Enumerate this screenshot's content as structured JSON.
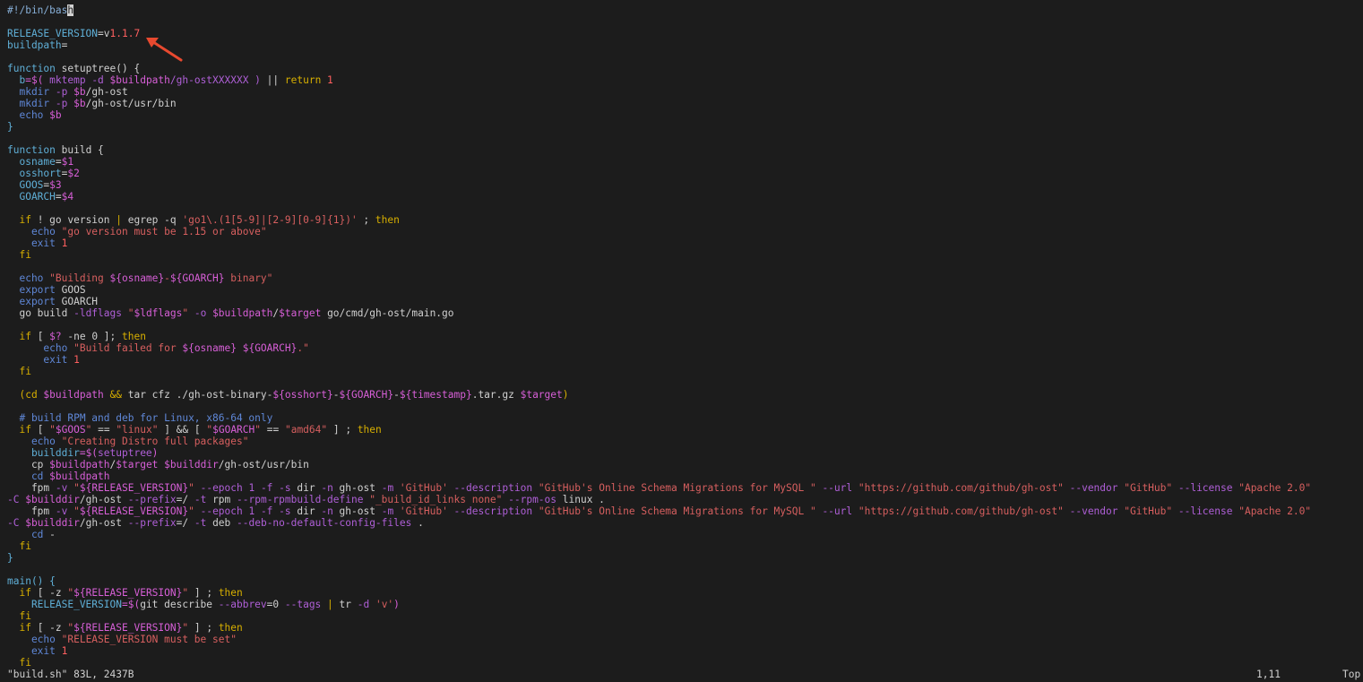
{
  "editor": {
    "lines": [
      [
        {
          "t": "#!/bin/bas",
          "c": "shebang"
        },
        {
          "t": "h",
          "c": "cursor"
        }
      ],
      [],
      [
        {
          "t": "RELEASE_VERSION",
          "c": "var"
        },
        {
          "t": "=v",
          "c": "pln"
        },
        {
          "t": "1.1.7",
          "c": "num"
        }
      ],
      [
        {
          "t": "buildpath",
          "c": "var"
        },
        {
          "t": "=",
          "c": "pln"
        }
      ],
      [],
      [
        {
          "t": "function",
          "c": "kw"
        },
        {
          "t": " setuptree() {",
          "c": "pln"
        }
      ],
      [
        {
          "t": "  b",
          "c": "var"
        },
        {
          "t": "=$( ",
          "c": "sub"
        },
        {
          "t": "mktemp -d ",
          "c": "opt"
        },
        {
          "t": "$buildpath",
          "c": "sub"
        },
        {
          "t": "/gh-ostXXXXXX ) ",
          "c": "opt"
        },
        {
          "t": "|| ",
          "c": "pln"
        },
        {
          "t": "return",
          "c": "ctl"
        },
        {
          "t": " 1",
          "c": "num"
        }
      ],
      [
        {
          "t": "  mkdir ",
          "c": "cmd"
        },
        {
          "t": "-p ",
          "c": "opt"
        },
        {
          "t": "$b",
          "c": "sub"
        },
        {
          "t": "/gh-ost",
          "c": "pln"
        }
      ],
      [
        {
          "t": "  mkdir ",
          "c": "cmd"
        },
        {
          "t": "-p ",
          "c": "opt"
        },
        {
          "t": "$b",
          "c": "sub"
        },
        {
          "t": "/gh-ost/usr/bin",
          "c": "pln"
        }
      ],
      [
        {
          "t": "  echo ",
          "c": "cmd"
        },
        {
          "t": "$b",
          "c": "sub"
        }
      ],
      [
        {
          "t": "}",
          "c": "brace"
        }
      ],
      [],
      [
        {
          "t": "function",
          "c": "kw"
        },
        {
          "t": " build {",
          "c": "pln"
        }
      ],
      [
        {
          "t": "  osname",
          "c": "var"
        },
        {
          "t": "=",
          "c": "pln"
        },
        {
          "t": "$1",
          "c": "sub"
        }
      ],
      [
        {
          "t": "  osshort",
          "c": "var"
        },
        {
          "t": "=",
          "c": "pln"
        },
        {
          "t": "$2",
          "c": "sub"
        }
      ],
      [
        {
          "t": "  GOOS",
          "c": "var"
        },
        {
          "t": "=",
          "c": "pln"
        },
        {
          "t": "$3",
          "c": "sub"
        }
      ],
      [
        {
          "t": "  GOARCH",
          "c": "var"
        },
        {
          "t": "=",
          "c": "pln"
        },
        {
          "t": "$4",
          "c": "sub"
        }
      ],
      [],
      [
        {
          "t": "  if",
          "c": "ctl"
        },
        {
          "t": " ! go version ",
          "c": "pln"
        },
        {
          "t": "| ",
          "c": "ctl"
        },
        {
          "t": "egrep -q ",
          "c": "pln"
        },
        {
          "t": "'go1\\.(1[5-9]|[2-9][0-9]{1})'",
          "c": "str"
        },
        {
          "t": " ; ",
          "c": "pln"
        },
        {
          "t": "then",
          "c": "ctl"
        }
      ],
      [
        {
          "t": "    echo ",
          "c": "cmd"
        },
        {
          "t": "\"go version must be 1.15 or above\"",
          "c": "str"
        }
      ],
      [
        {
          "t": "    exit ",
          "c": "cmd"
        },
        {
          "t": "1",
          "c": "num"
        }
      ],
      [
        {
          "t": "  fi",
          "c": "ctl"
        }
      ],
      [],
      [
        {
          "t": "  echo ",
          "c": "cmd"
        },
        {
          "t": "\"Building ",
          "c": "str"
        },
        {
          "t": "${osname}",
          "c": "sub"
        },
        {
          "t": "-",
          "c": "str"
        },
        {
          "t": "${GOARCH}",
          "c": "sub"
        },
        {
          "t": " binary\"",
          "c": "str"
        }
      ],
      [
        {
          "t": "  export ",
          "c": "cmd"
        },
        {
          "t": "GOOS",
          "c": "pln"
        }
      ],
      [
        {
          "t": "  export ",
          "c": "cmd"
        },
        {
          "t": "GOARCH",
          "c": "pln"
        }
      ],
      [
        {
          "t": "  go build ",
          "c": "pln"
        },
        {
          "t": "-ldflags ",
          "c": "opt"
        },
        {
          "t": "\"",
          "c": "str"
        },
        {
          "t": "$ldflags",
          "c": "sub"
        },
        {
          "t": "\" ",
          "c": "str"
        },
        {
          "t": "-o ",
          "c": "opt"
        },
        {
          "t": "$buildpath",
          "c": "sub"
        },
        {
          "t": "/",
          "c": "pln"
        },
        {
          "t": "$target",
          "c": "sub"
        },
        {
          "t": " go/cmd/gh-ost/main.go",
          "c": "pln"
        }
      ],
      [],
      [
        {
          "t": "  if",
          "c": "ctl"
        },
        {
          "t": " [ ",
          "c": "pln"
        },
        {
          "t": "$?",
          "c": "sub"
        },
        {
          "t": " -ne 0 ]; ",
          "c": "pln"
        },
        {
          "t": "then",
          "c": "ctl"
        }
      ],
      [
        {
          "t": "      echo ",
          "c": "cmd"
        },
        {
          "t": "\"Build failed for ",
          "c": "str"
        },
        {
          "t": "${osname}",
          "c": "sub"
        },
        {
          "t": " ",
          "c": "str"
        },
        {
          "t": "${GOARCH}",
          "c": "sub"
        },
        {
          "t": ".\"",
          "c": "str"
        }
      ],
      [
        {
          "t": "      exit ",
          "c": "cmd"
        },
        {
          "t": "1",
          "c": "num"
        }
      ],
      [
        {
          "t": "  fi",
          "c": "ctl"
        }
      ],
      [],
      [
        {
          "t": "  (cd ",
          "c": "ctl"
        },
        {
          "t": "$buildpath",
          "c": "sub"
        },
        {
          "t": " && ",
          "c": "ctl"
        },
        {
          "t": "tar cfz ./gh-ost-binary-",
          "c": "pln"
        },
        {
          "t": "${osshort}",
          "c": "sub"
        },
        {
          "t": "-",
          "c": "pln"
        },
        {
          "t": "${GOARCH}",
          "c": "sub"
        },
        {
          "t": "-",
          "c": "pln"
        },
        {
          "t": "${timestamp}",
          "c": "sub"
        },
        {
          "t": ".tar.gz ",
          "c": "pln"
        },
        {
          "t": "$target",
          "c": "sub"
        },
        {
          "t": ")",
          "c": "ctl"
        }
      ],
      [],
      [
        {
          "t": "  # build RPM and deb for Linux, x86-64 only",
          "c": "cmt"
        }
      ],
      [
        {
          "t": "  if",
          "c": "ctl"
        },
        {
          "t": " [ ",
          "c": "pln"
        },
        {
          "t": "\"",
          "c": "str"
        },
        {
          "t": "$GOOS",
          "c": "sub"
        },
        {
          "t": "\"",
          "c": "str"
        },
        {
          "t": " == ",
          "c": "pln"
        },
        {
          "t": "\"linux\"",
          "c": "str"
        },
        {
          "t": " ] && [ ",
          "c": "pln"
        },
        {
          "t": "\"",
          "c": "str"
        },
        {
          "t": "$GOARCH",
          "c": "sub"
        },
        {
          "t": "\"",
          "c": "str"
        },
        {
          "t": " == ",
          "c": "pln"
        },
        {
          "t": "\"amd64\"",
          "c": "str"
        },
        {
          "t": " ] ; ",
          "c": "pln"
        },
        {
          "t": "then",
          "c": "ctl"
        }
      ],
      [
        {
          "t": "    echo ",
          "c": "cmd"
        },
        {
          "t": "\"Creating Distro full packages\"",
          "c": "str"
        }
      ],
      [
        {
          "t": "    builddir",
          "c": "var"
        },
        {
          "t": "=$(",
          "c": "sub"
        },
        {
          "t": "setuptree",
          "c": "opt"
        },
        {
          "t": ")",
          "c": "sub"
        }
      ],
      [
        {
          "t": "    cp ",
          "c": "pln"
        },
        {
          "t": "$buildpath",
          "c": "sub"
        },
        {
          "t": "/",
          "c": "pln"
        },
        {
          "t": "$target",
          "c": "sub"
        },
        {
          "t": " ",
          "c": "pln"
        },
        {
          "t": "$builddir",
          "c": "sub"
        },
        {
          "t": "/gh-ost/usr/bin",
          "c": "pln"
        }
      ],
      [
        {
          "t": "    cd ",
          "c": "cmd"
        },
        {
          "t": "$buildpath",
          "c": "sub"
        }
      ],
      [
        {
          "t": "    fpm ",
          "c": "pln"
        },
        {
          "t": "-v ",
          "c": "opt"
        },
        {
          "t": "\"",
          "c": "str"
        },
        {
          "t": "${RELEASE_VERSION}",
          "c": "sub"
        },
        {
          "t": "\"",
          "c": "str"
        },
        {
          "t": " --epoch 1 -f -s ",
          "c": "opt"
        },
        {
          "t": "dir ",
          "c": "pln"
        },
        {
          "t": "-n ",
          "c": "opt"
        },
        {
          "t": "gh-ost ",
          "c": "pln"
        },
        {
          "t": "-m ",
          "c": "opt"
        },
        {
          "t": "'GitHub'",
          "c": "str"
        },
        {
          "t": " --description ",
          "c": "opt"
        },
        {
          "t": "\"GitHub's Online Schema Migrations for MySQL \"",
          "c": "str"
        },
        {
          "t": " --url ",
          "c": "opt"
        },
        {
          "t": "\"https://github.com/github/gh-ost\"",
          "c": "str"
        },
        {
          "t": " --vendor ",
          "c": "opt"
        },
        {
          "t": "\"GitHub\"",
          "c": "str"
        },
        {
          "t": " --license ",
          "c": "opt"
        },
        {
          "t": "\"Apache 2.0\"",
          "c": "str"
        }
      ],
      [
        {
          "t": "-C ",
          "c": "opt"
        },
        {
          "t": "$builddir",
          "c": "sub"
        },
        {
          "t": "/gh-ost ",
          "c": "pln"
        },
        {
          "t": "--prefix",
          "c": "opt"
        },
        {
          "t": "=/ ",
          "c": "pln"
        },
        {
          "t": "-t ",
          "c": "opt"
        },
        {
          "t": "rpm ",
          "c": "pln"
        },
        {
          "t": "--rpm-rpmbuild-define ",
          "c": "opt"
        },
        {
          "t": "\"_build_id_links none\"",
          "c": "str"
        },
        {
          "t": " --rpm-os ",
          "c": "opt"
        },
        {
          "t": "linux .",
          "c": "pln"
        }
      ],
      [
        {
          "t": "    fpm ",
          "c": "pln"
        },
        {
          "t": "-v ",
          "c": "opt"
        },
        {
          "t": "\"",
          "c": "str"
        },
        {
          "t": "${RELEASE_VERSION}",
          "c": "sub"
        },
        {
          "t": "\"",
          "c": "str"
        },
        {
          "t": " --epoch 1 -f -s ",
          "c": "opt"
        },
        {
          "t": "dir ",
          "c": "pln"
        },
        {
          "t": "-n ",
          "c": "opt"
        },
        {
          "t": "gh-ost ",
          "c": "pln"
        },
        {
          "t": "-m ",
          "c": "opt"
        },
        {
          "t": "'GitHub'",
          "c": "str"
        },
        {
          "t": " --description ",
          "c": "opt"
        },
        {
          "t": "\"GitHub's Online Schema Migrations for MySQL \"",
          "c": "str"
        },
        {
          "t": " --url ",
          "c": "opt"
        },
        {
          "t": "\"https://github.com/github/gh-ost\"",
          "c": "str"
        },
        {
          "t": " --vendor ",
          "c": "opt"
        },
        {
          "t": "\"GitHub\"",
          "c": "str"
        },
        {
          "t": " --license ",
          "c": "opt"
        },
        {
          "t": "\"Apache 2.0\"",
          "c": "str"
        }
      ],
      [
        {
          "t": "-C ",
          "c": "opt"
        },
        {
          "t": "$builddir",
          "c": "sub"
        },
        {
          "t": "/gh-ost ",
          "c": "pln"
        },
        {
          "t": "--prefix",
          "c": "opt"
        },
        {
          "t": "=/ ",
          "c": "pln"
        },
        {
          "t": "-t ",
          "c": "opt"
        },
        {
          "t": "deb ",
          "c": "pln"
        },
        {
          "t": "--deb-no-default-config-files ",
          "c": "opt"
        },
        {
          "t": ".",
          "c": "pln"
        }
      ],
      [
        {
          "t": "    cd ",
          "c": "cmd"
        },
        {
          "t": "-",
          "c": "pln"
        }
      ],
      [
        {
          "t": "  fi",
          "c": "ctl"
        }
      ],
      [
        {
          "t": "}",
          "c": "brace"
        }
      ],
      [],
      [
        {
          "t": "main() {",
          "c": "kw"
        }
      ],
      [
        {
          "t": "  if",
          "c": "ctl"
        },
        {
          "t": " [ -z ",
          "c": "pln"
        },
        {
          "t": "\"",
          "c": "str"
        },
        {
          "t": "${RELEASE_VERSION}",
          "c": "sub"
        },
        {
          "t": "\"",
          "c": "str"
        },
        {
          "t": " ] ; ",
          "c": "pln"
        },
        {
          "t": "then",
          "c": "ctl"
        }
      ],
      [
        {
          "t": "    RELEASE_VERSION",
          "c": "var"
        },
        {
          "t": "=$(",
          "c": "sub"
        },
        {
          "t": "git describe ",
          "c": "pln"
        },
        {
          "t": "--abbrev",
          "c": "opt"
        },
        {
          "t": "=0 ",
          "c": "pln"
        },
        {
          "t": "--tags ",
          "c": "opt"
        },
        {
          "t": "| ",
          "c": "ctl"
        },
        {
          "t": "tr ",
          "c": "pln"
        },
        {
          "t": "-d ",
          "c": "opt"
        },
        {
          "t": "'v'",
          "c": "str"
        },
        {
          "t": ")",
          "c": "sub"
        }
      ],
      [
        {
          "t": "  fi",
          "c": "ctl"
        }
      ],
      [
        {
          "t": "  if",
          "c": "ctl"
        },
        {
          "t": " [ -z ",
          "c": "pln"
        },
        {
          "t": "\"",
          "c": "str"
        },
        {
          "t": "${RELEASE_VERSION}",
          "c": "sub"
        },
        {
          "t": "\"",
          "c": "str"
        },
        {
          "t": " ] ; ",
          "c": "pln"
        },
        {
          "t": "then",
          "c": "ctl"
        }
      ],
      [
        {
          "t": "    echo ",
          "c": "cmd"
        },
        {
          "t": "\"RELEASE_VERSION must be set\"",
          "c": "str"
        }
      ],
      [
        {
          "t": "    exit ",
          "c": "cmd"
        },
        {
          "t": "1",
          "c": "num"
        }
      ],
      [
        {
          "t": "  fi",
          "c": "ctl"
        }
      ]
    ]
  },
  "status": {
    "file": "\"build.sh\" 83L, 2437B",
    "position": "1,11",
    "scroll": "Top"
  },
  "annotation": {
    "arrow_color": "#e8492f"
  }
}
